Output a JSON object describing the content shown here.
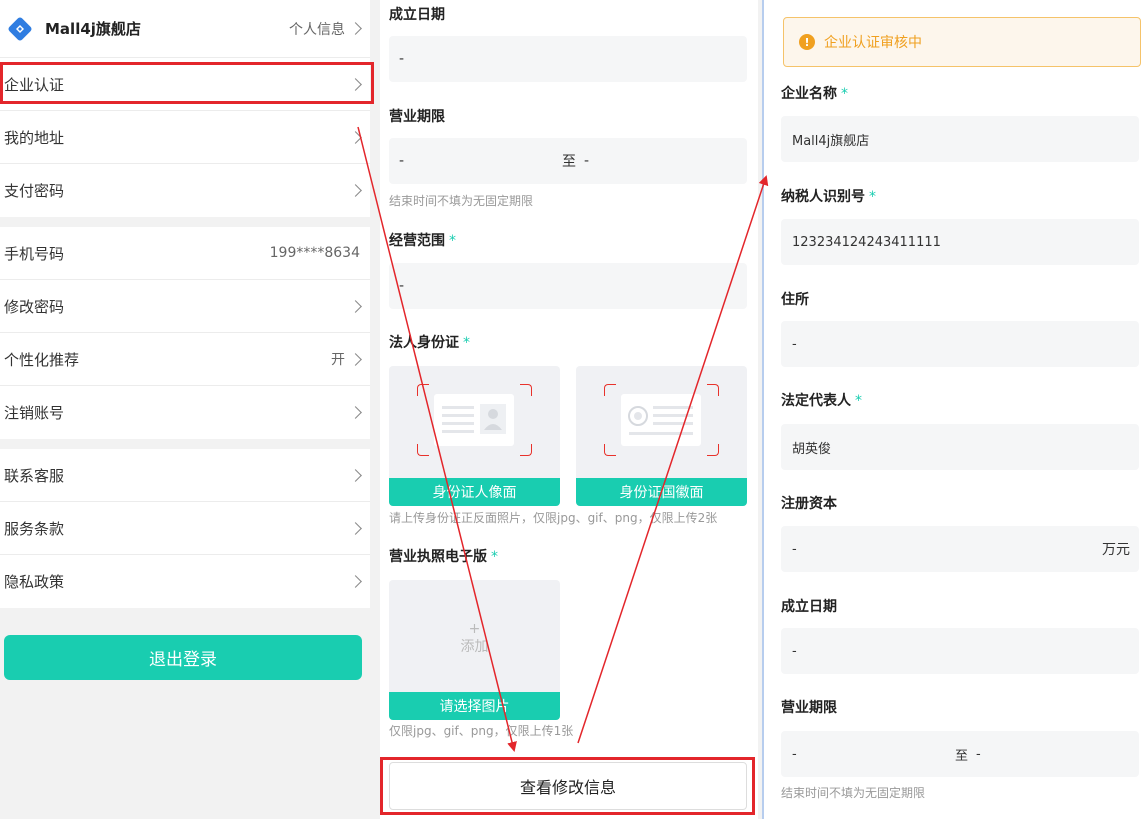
{
  "left": {
    "shop_name": "Mall4j旗舰店",
    "profile_link": "个人信息",
    "group1": [
      {
        "label": "企业认证",
        "value": ""
      },
      {
        "label": "我的地址",
        "value": ""
      },
      {
        "label": "支付密码",
        "value": ""
      }
    ],
    "group2": [
      {
        "label": "手机号码",
        "value": "199****8634"
      },
      {
        "label": "修改密码",
        "value": ""
      },
      {
        "label": "个性化推荐",
        "value": "开"
      },
      {
        "label": "注销账号",
        "value": ""
      }
    ],
    "group3": [
      {
        "label": "联系客服",
        "value": ""
      },
      {
        "label": "服务条款",
        "value": ""
      },
      {
        "label": "隐私政策",
        "value": ""
      }
    ],
    "logout": "退出登录"
  },
  "middle": {
    "founding_date_label": "成立日期",
    "founding_date_value": "-",
    "business_term_label": "营业期限",
    "business_term_start": "-",
    "business_term_to": "至",
    "business_term_end": "-",
    "business_term_hint": "结束时间不填为无固定期限",
    "scope_label": "经营范围",
    "scope_value": "-",
    "id_label": "法人身份证",
    "id_front_caption": "身份证人像面",
    "id_back_caption": "身份证国徽面",
    "id_hint": "请上传身份证正反面照片，仅限jpg、gif、png，仅限上传2张",
    "license_label": "营业执照电子版",
    "license_plus": "+",
    "license_add": "添加",
    "license_caption": "请选择图片",
    "license_hint": "仅限jpg、gif、png，仅限上传1张",
    "view_button": "查看修改信息",
    "required_mark": "*"
  },
  "right": {
    "notice": "企业认证审核中",
    "notice_icon": "!",
    "company_name_label": "企业名称",
    "company_name_value": "Mall4j旗舰店",
    "tax_id_label": "纳税人识别号",
    "tax_id_value": "123234124243411111",
    "address_label": "住所",
    "address_value": "-",
    "legal_rep_label": "法定代表人",
    "legal_rep_value": "胡英俊",
    "capital_label": "注册资本",
    "capital_value": "-",
    "capital_unit": "万元",
    "founding_date_label": "成立日期",
    "founding_date_value": "-",
    "business_term_label": "营业期限",
    "business_term_start": "-",
    "business_term_to": "至",
    "business_term_end": "-",
    "business_term_hint": "结束时间不填为无固定期限",
    "required_mark": "*"
  },
  "colors": {
    "accent": "#19cdb0",
    "annotation": "#e3262b",
    "warning": "#f0a020"
  },
  "icons": [
    "chevron-right-icon",
    "brand-logo-icon",
    "id-card-portrait-icon",
    "id-card-emblem-icon",
    "warning-icon",
    "plus-icon"
  ]
}
